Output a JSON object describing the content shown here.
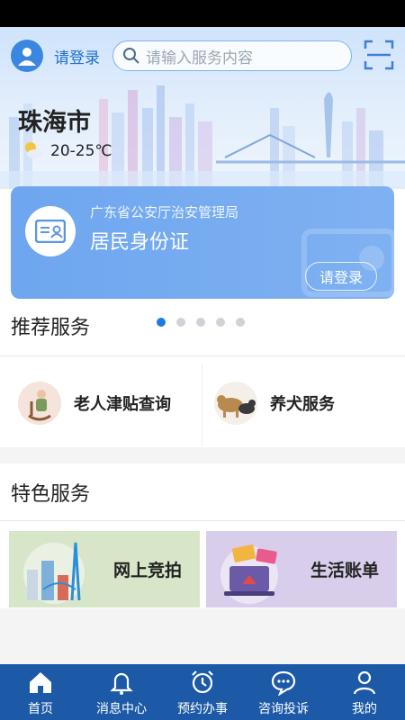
{
  "header": {
    "login_link": "请登录",
    "search_placeholder": "请输入服务内容",
    "city": "珠海市",
    "temperature": "20-25℃",
    "icons": [
      "user-icon",
      "search-icon",
      "scan-icon",
      "partly-sunny-icon"
    ]
  },
  "id_card": {
    "department": "广东省公安厅治安管理局",
    "title": "居民身份证",
    "login_button": "请登录",
    "icon": "id-card-icon"
  },
  "recommended": {
    "title": "推荐服务",
    "carousel_pages": 5,
    "carousel_active_index": 0,
    "items": [
      {
        "label": "老人津贴查询",
        "icon": "elderly-person-icon"
      },
      {
        "label": "养犬服务",
        "icon": "dogs-icon"
      }
    ]
  },
  "featured": {
    "title": "特色服务",
    "items": [
      {
        "label": "网上竞拍",
        "icon": "auction-building-icon",
        "bg": "#d7e6c8",
        "color": "#222222"
      },
      {
        "label": "生活账单",
        "icon": "bill-laptop-icon",
        "bg": "#d9cdec",
        "color": "#222222"
      }
    ]
  },
  "tabbar": {
    "items": [
      {
        "label": "首页",
        "icon": "home-icon"
      },
      {
        "label": "消息中心",
        "icon": "bell-icon"
      },
      {
        "label": "预约办事",
        "icon": "alarm-clock-icon"
      },
      {
        "label": "咨询投诉",
        "icon": "chat-bubble-icon"
      },
      {
        "label": "我的",
        "icon": "profile-icon"
      }
    ],
    "active_index": 0
  },
  "colors": {
    "accent": "#1d7ae6",
    "tabbar_bg": "#1c5aa7",
    "card_bg": "#7fb1f2"
  }
}
